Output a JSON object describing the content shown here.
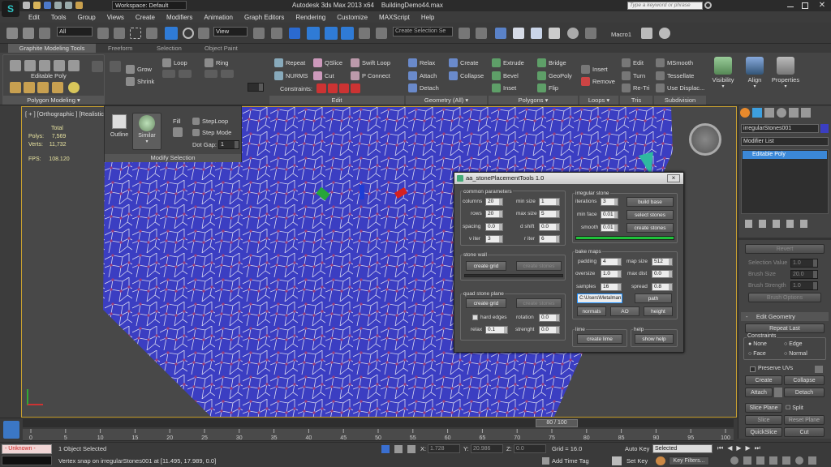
{
  "title_bar": {
    "workspace_label": "Workspace: Default",
    "app_title": "Autodesk 3ds Max  2013 x64",
    "file_name": "BuildingDemo44.max",
    "search_placeholder": "Type a keyword or phrase"
  },
  "menu": [
    "Edit",
    "Tools",
    "Group",
    "Views",
    "Create",
    "Modifiers",
    "Animation",
    "Graph Editors",
    "Rendering",
    "Customize",
    "MAXScript",
    "Help"
  ],
  "toolbar": {
    "selection_filter": "All",
    "reference_coord": "View",
    "selection_set": "Create Selection Se",
    "macro_label": "Macro1"
  },
  "ribbon": {
    "tabs": [
      "Graphite Modeling Tools",
      "Freeform",
      "Selection",
      "Object Paint"
    ],
    "active_object_label": "Editable Poly",
    "polygon_modeling_label": "Polygon Modeling",
    "grow": "Grow",
    "shrink": "Shrink",
    "loop": "Loop",
    "ring": "Ring",
    "edit": {
      "repeat": "Repeat",
      "qslice": "QSlice",
      "swift_loop": "Swift Loop",
      "nurms": "NURMS",
      "cut": "Cut",
      "p_connect": "P Connect",
      "constraints": "Constraints:",
      "panel": "Edit"
    },
    "geometry": {
      "relax": "Relax",
      "create": "Create",
      "attach": "Attach",
      "collapse": "Collapse",
      "detach": "Detach",
      "panel": "Geometry (All)"
    },
    "polygons": {
      "extrude": "Extrude",
      "bridge": "Bridge",
      "bevel": "Bevel",
      "geopoly": "GeoPoly",
      "inset": "Inset",
      "flip": "Flip",
      "panel": "Polygons"
    },
    "loops": {
      "insert": "Insert",
      "remove": "Remove",
      "panel": "Loops"
    },
    "tris": {
      "edit": "Edit",
      "turn": "Turn",
      "retri": "Re-Tri",
      "panel": "Tris"
    },
    "subdivision": {
      "msmooth": "MSmooth",
      "tessellate": "Tessellate",
      "use_displace": "Use Displac...",
      "panel": "Subdivision"
    },
    "big_buttons": [
      "Visibility",
      "Align",
      "Properties"
    ]
  },
  "modify_selection": {
    "outline": "Outline",
    "similar": "Similar",
    "fill": "Fill",
    "steploop": "StepLoop",
    "stepmode": "Step Mode",
    "dot_gap_label": "Dot Gap:",
    "dot_gap_value": "1",
    "panel": "Modify Selection"
  },
  "viewport": {
    "label": "[ + ] [Orthographic ] [Realistic ]",
    "stats": {
      "total": "Total",
      "polys_label": "Polys:",
      "polys": "7,569",
      "verts_label": "Verts:",
      "verts": "11,732",
      "fps_label": "FPS:",
      "fps": "108.120"
    }
  },
  "dialog": {
    "title": "aa_stonePlacementTools 1.0",
    "close": "×",
    "common": {
      "title": "common parameters",
      "columns_label": "columns",
      "columns": "20",
      "rows_label": "rows",
      "rows": "20",
      "spacing_label": "spacing",
      "spacing": "0.0",
      "v_iter_label": "v iter",
      "v_iter": "3",
      "min_size_label": "min size",
      "min_size": "1",
      "max_size_label": "max size",
      "max_size": "5",
      "d_shift_label": "d shift",
      "d_shift": "0.0",
      "r_iter_label": "r iter",
      "r_iter": "6"
    },
    "stone_wall": {
      "title": "stone wall",
      "create_grid": "create grid",
      "create_stones": "create stones"
    },
    "quad": {
      "title": "quad stone plane",
      "create_grid": "create grid",
      "create_stones": "create stones",
      "hard_edges": "hard edges",
      "rotation_label": "rotation",
      "rotation": "0.0",
      "relax_label": "relax",
      "relax": "0.1",
      "strength_label": "strenght",
      "strength": "0.0"
    },
    "irregular": {
      "title": "irregular stone",
      "iterations_label": "iterations",
      "iterations": "3",
      "min_face_label": "min face",
      "min_face": "0.01",
      "smooth_label": "smooth",
      "smooth": "0.01",
      "build_base": "build base",
      "select_stones": "select stones",
      "create_stones": "create stones",
      "progress": 1.0
    },
    "bake": {
      "title": "bake maps",
      "padding_label": "padding",
      "padding": "4",
      "oversize_label": "oversize",
      "oversize": "1.0",
      "samples_label": "samples",
      "samples": "16",
      "map_size_label": "map size",
      "map_size": "512",
      "max_dist_label": "max dist",
      "max_dist": "0.0",
      "spread_label": "spread",
      "spread": "0.8",
      "path_value": "C:\\Users\\Metalman123\\",
      "path": "path",
      "normals": "normals",
      "ao": "AO",
      "height": "height"
    },
    "lime": {
      "title": "lime",
      "create_lime": "create lime"
    },
    "help": {
      "title": "help",
      "show_help": "show help"
    }
  },
  "command_panel": {
    "object_name": "irregularStones001",
    "modifier_list": "Modifier List",
    "stack_item": "Editable Poly",
    "revert": "Revert",
    "selection_value_label": "Selection Value",
    "selection_value": "1.0",
    "brush_size_label": "Brush Size",
    "brush_size": "20.0",
    "brush_strength_label": "Brush Strength",
    "brush_strength": "1.0",
    "brush_options": "Brush Options",
    "edit_geometry": "Edit Geometry",
    "repeat_last": "Repeat Last",
    "constraints": "Constraints",
    "none": "None",
    "edge": "Edge",
    "face": "Face",
    "normal": "Normal",
    "preserve_uvs": "Preserve UVs",
    "create": "Create",
    "collapse": "Collapse",
    "attach": "Attach",
    "detach": "Detach",
    "slice_plane": "Slice Plane",
    "split": "Split",
    "slice": "Slice",
    "reset_plane": "Reset Plane",
    "quickslice": "QuickSlice",
    "cut": "Cut"
  },
  "timeline": {
    "frame": "80 / 100",
    "ticks": [
      "0",
      "5",
      "10",
      "15",
      "20",
      "25",
      "30",
      "35",
      "40",
      "45",
      "50",
      "55",
      "60",
      "65",
      "70",
      "75",
      "80",
      "85",
      "90",
      "95",
      "100"
    ]
  },
  "status": {
    "objects_selected": "1 Object Selected",
    "prompt": "Vertex snap on irregularStones001 at [11.495, 17.989, 0.0]",
    "maxscript": "- Unknown -",
    "x_label": "X:",
    "x": "1.728",
    "y_label": "Y:",
    "y": "20.986",
    "z_label": "Z:",
    "z": "0.0",
    "grid": "Grid = 16.0",
    "add_time_tag": "Add Time Tag",
    "auto_key": "Auto Key",
    "selected": "Selected",
    "set_key": "Set Key",
    "key_filters": "Key Filters..."
  },
  "colors": {
    "viewport_mesh": "#3b3ec2",
    "dialog_bg": "#4a4a4a",
    "accent": "#1e90ff",
    "progress": "#1fc23a"
  }
}
